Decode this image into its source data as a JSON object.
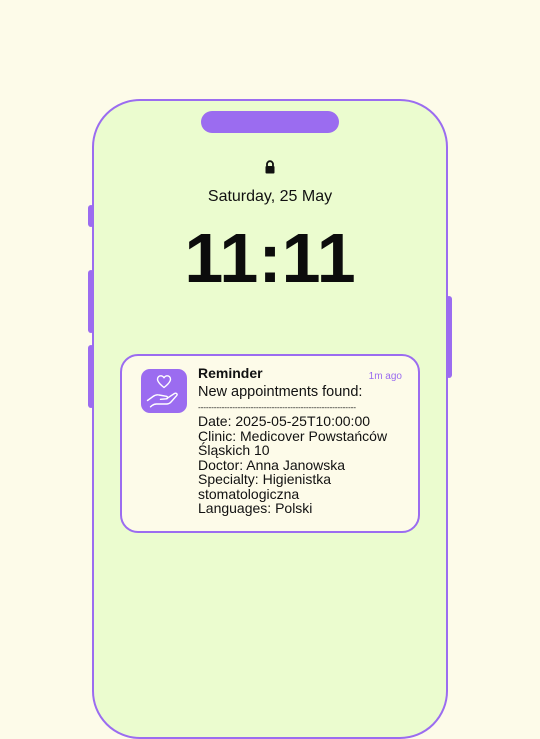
{
  "status": {
    "lock_icon": "lock-icon"
  },
  "lockscreen": {
    "date": "Saturday, 25 May",
    "time": "11:11"
  },
  "notification": {
    "app_icon": "heart-hand-icon",
    "title": "Reminder",
    "timestamp": "1m ago",
    "heading": "New appointments found:",
    "separator": "------------------------------------------------------------",
    "date_line": "Date: 2025-05-25T10:00:00",
    "clinic_line": "Clinic: Medicover Powstańców Śląskich 10",
    "doctor_line": "Doctor: Anna Janowska",
    "specialty_line": "Specialty: Higienistka stomatologiczna",
    "languages_line": "Languages: Polski"
  },
  "colors": {
    "background": "#fdfbe9",
    "screen": "#ebfccf",
    "accent": "#9b6cf0"
  }
}
